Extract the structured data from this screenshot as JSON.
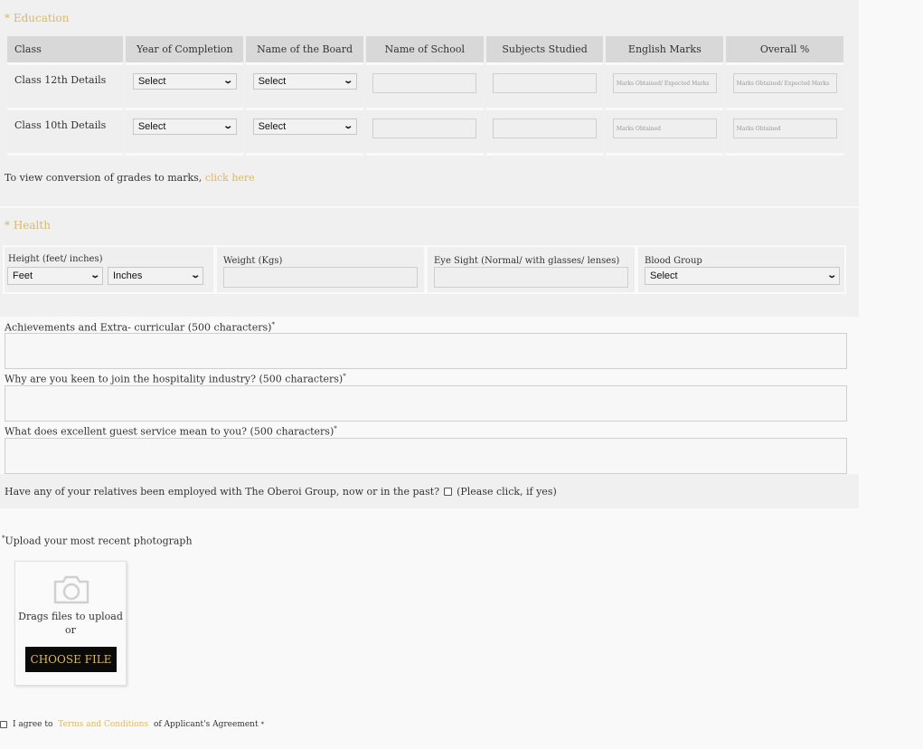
{
  "education": {
    "title": "* Education",
    "headers": [
      "Class",
      "Year of Completion",
      "Name of the Board",
      "Name of School",
      "Subjects Studied",
      "English Marks",
      "Overall %"
    ],
    "rows": [
      {
        "class_label": "Class 12th Details",
        "year_select": "Select",
        "board_select": "Select",
        "school_value": "",
        "subjects_value": "",
        "english_placeholder": "Marks Obtained/ Expected Marks",
        "overall_placeholder": "Marks Obtained/ Expected Marks"
      },
      {
        "class_label": "Class 10th Details",
        "year_select": "Select",
        "board_select": "Select",
        "school_value": "",
        "subjects_value": "",
        "english_placeholder": "Marks Obtained",
        "overall_placeholder": "Marks Obtained"
      }
    ],
    "conversion_note": "To view conversion of grades to marks, ",
    "conversion_link": "click here"
  },
  "health": {
    "title": "* Health",
    "height_label": "Height (feet/ inches)",
    "feet_select": "Feet",
    "inches_select": "Inches",
    "weight_label": "Weight (Kgs)",
    "weight_value": "",
    "eyesight_label": "Eye Sight (Normal/ with glasses/ lenses)",
    "eyesight_value": "",
    "blood_group_label": "Blood Group",
    "blood_group_select": "Select"
  },
  "questions": [
    {
      "label": "Achievements and Extra- curricular (500 characters)",
      "required": "*",
      "value": ""
    },
    {
      "label": "Why are you keen to join the hospitality industry? (500 characters)",
      "required": "*",
      "value": ""
    },
    {
      "label": "What does excellent guest service mean to you? (500 characters)",
      "required": "*",
      "value": ""
    }
  ],
  "relatives": {
    "question": "Have any of your relatives been employed with The Oberoi Group, now or in the past?",
    "checked": false,
    "hint": "(Please click, if yes)"
  },
  "upload": {
    "required": "*",
    "label": "Upload your most recent photograph",
    "icon": "camera-icon",
    "drag_text": "Drags files to upload",
    "or_text": "or",
    "button_label": "CHOOSE FILE"
  },
  "agreement": {
    "checked": false,
    "prefix": "I agree to ",
    "link": "Terms and Conditions",
    "suffix": " of Applicant's Agreement",
    "required": "*"
  },
  "colors": {
    "accent": "#d9b96a",
    "section_bg": "#f0f0f0",
    "page_bg": "#f9f9f9",
    "header_bg": "#d8d8d8",
    "button_bg": "#0a0a0a"
  }
}
